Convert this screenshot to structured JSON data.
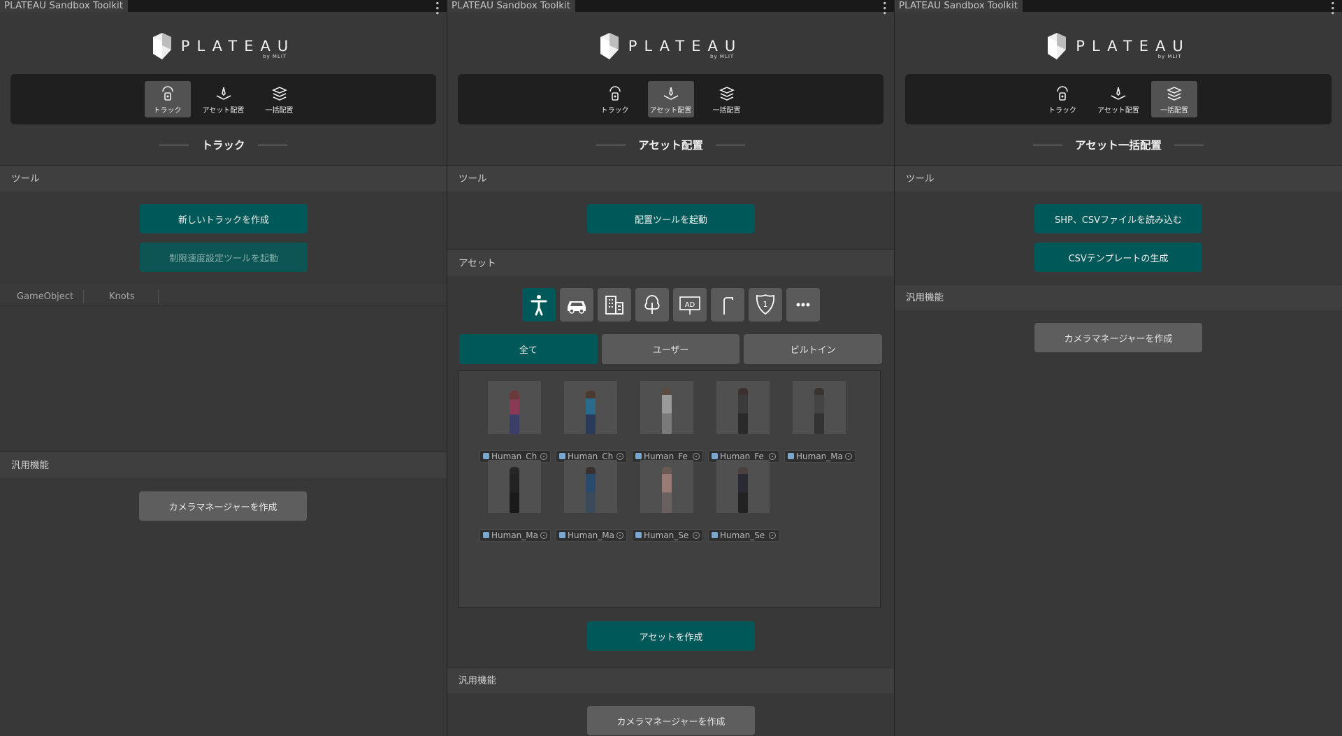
{
  "window_title": "PLATEAU Sandbox Toolkit",
  "logo": {
    "title": "PLATEAU",
    "subtitle": "by MLIT"
  },
  "modes": {
    "track": "トラック",
    "asset": "アセット配置",
    "bulk": "一括配置"
  },
  "panels": [
    {
      "heading": "トラック",
      "active_mode": "track",
      "tools_label": "ツール",
      "buttons": [
        "新しいトラックを作成",
        "制限速度設定ツールを起動"
      ],
      "columns": [
        "GameObject",
        "Knots"
      ],
      "general_label": "汎用機能",
      "general_button": "カメラマネージャーを作成"
    },
    {
      "heading": "アセット配置",
      "active_mode": "asset",
      "tools_label": "ツール",
      "launch_button": "配置ツールを起動",
      "assets_label": "アセット",
      "categories": [
        "person-icon",
        "car-icon",
        "building-icon",
        "tree-icon",
        "ad-sign-icon",
        "street-light-icon",
        "route-sign-icon",
        "more-icon"
      ],
      "category_ad_text": "AD",
      "category_route_text": "1",
      "filters": [
        "全て",
        "ユーザー",
        "ビルトイン"
      ],
      "assets": [
        "Human_Ch",
        "Human_Ch",
        "Human_Fe",
        "Human_Fe",
        "Human_Ma",
        "Human_Ma",
        "Human_Ma",
        "Human_Se",
        "Human_Se"
      ],
      "create_button": "アセットを作成",
      "general_label": "汎用機能",
      "general_button": "カメラマネージャーを作成"
    },
    {
      "heading": "アセット一括配置",
      "active_mode": "bulk",
      "tools_label": "ツール",
      "buttons": [
        "SHP、CSVファイルを読み込む",
        "CSVテンプレートの生成"
      ],
      "general_label": "汎用機能",
      "general_button": "カメラマネージャーを作成"
    }
  ],
  "colors": {
    "accent": "#005858",
    "background": "#383838",
    "dark_bar": "#1f1f1f"
  }
}
